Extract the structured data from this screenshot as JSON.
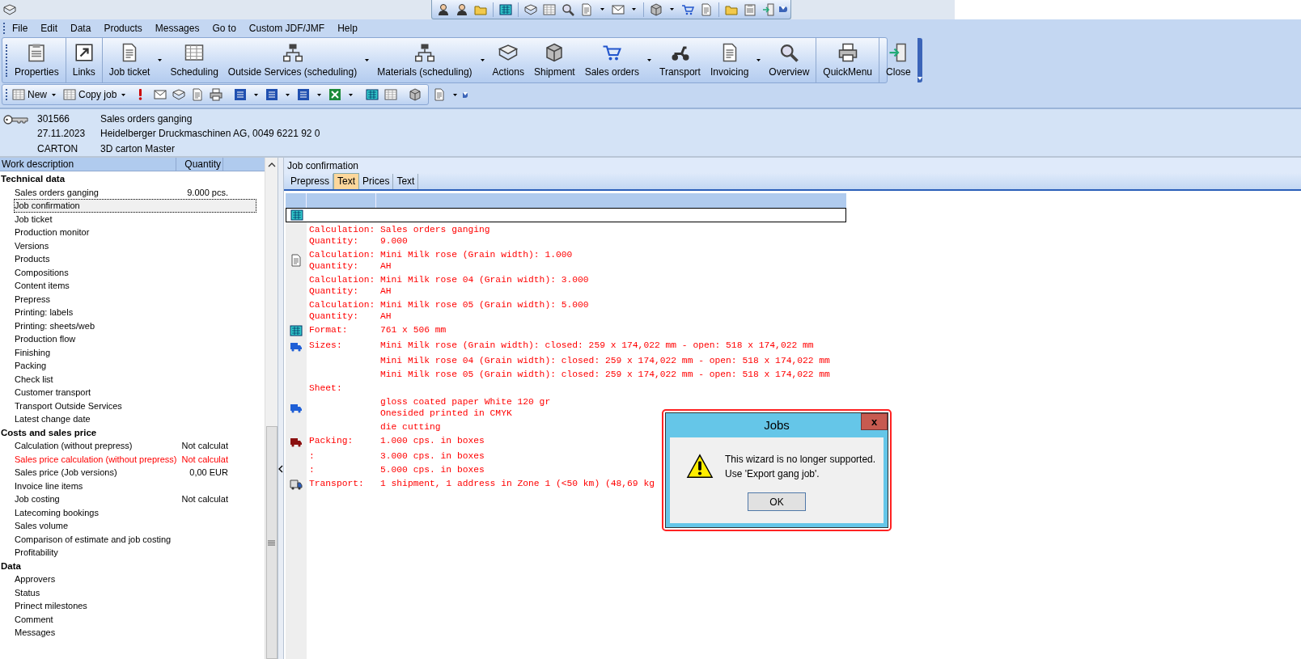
{
  "menu": [
    "File",
    "Edit",
    "Data",
    "Products",
    "Messages",
    "Go to",
    "Custom JDF/JMF",
    "Help"
  ],
  "main_toolbar": {
    "groups": [
      {
        "buttons": [
          {
            "label": "Properties",
            "dropdown": false
          }
        ]
      },
      {
        "buttons": [
          {
            "label": "Links",
            "dropdown": false
          }
        ]
      },
      {
        "buttons": [
          {
            "label": "Job ticket",
            "dropdown": true
          },
          {
            "label": "Scheduling",
            "dropdown": false
          },
          {
            "label": "Outside Services (scheduling)",
            "dropdown": true
          },
          {
            "label": "Materials (scheduling)",
            "dropdown": true
          },
          {
            "label": "Actions",
            "dropdown": false
          },
          {
            "label": "Shipment",
            "dropdown": false
          },
          {
            "label": "Sales orders",
            "dropdown": true
          },
          {
            "label": "Transport",
            "dropdown": false
          },
          {
            "label": "Invoicing",
            "dropdown": true
          },
          {
            "label": "Overview",
            "dropdown": false
          }
        ]
      },
      {
        "buttons": [
          {
            "label": "QuickMenu",
            "dropdown": false
          }
        ]
      },
      {
        "buttons": [
          {
            "label": "Close",
            "dropdown": false
          }
        ]
      }
    ]
  },
  "small_toolbar": {
    "buttons": [
      {
        "label": "New",
        "dropdown": true
      },
      {
        "label": "Copy job",
        "dropdown": true
      }
    ]
  },
  "job_header": {
    "number": "301566",
    "name": "Sales orders ganging",
    "date": "27.11.2023",
    "customer": "Heidelberger Druckmaschinen AG, 0049 6221 92 0",
    "type": "CARTON",
    "product": "3D carton Master"
  },
  "work_list": {
    "columns": [
      "Work description",
      "Quantity"
    ],
    "groups": [
      {
        "label": "Technical data",
        "items": [
          {
            "label": "Sales orders ganging",
            "quantity": "9.000 pcs.",
            "selected": false,
            "warning": false
          },
          {
            "label": "Job confirmation",
            "selected": true,
            "warning": false
          },
          {
            "label": "Job ticket",
            "selected": false,
            "warning": false
          },
          {
            "label": "Production monitor",
            "selected": false,
            "warning": false
          },
          {
            "label": "Versions",
            "selected": false,
            "warning": false
          },
          {
            "label": "Products",
            "selected": false,
            "warning": false
          },
          {
            "label": "Compositions",
            "selected": false,
            "warning": false
          },
          {
            "label": "Content items",
            "selected": false,
            "warning": false
          },
          {
            "label": "Prepress",
            "selected": false,
            "warning": false
          },
          {
            "label": "Printing: labels",
            "selected": false,
            "warning": false
          },
          {
            "label": "Printing: sheets/web",
            "selected": false,
            "warning": false
          },
          {
            "label": "Production flow",
            "selected": false,
            "warning": false
          },
          {
            "label": "Finishing",
            "selected": false,
            "warning": false
          },
          {
            "label": "Packing",
            "selected": false,
            "warning": false
          },
          {
            "label": "Check list",
            "selected": false,
            "warning": false
          },
          {
            "label": "Customer transport",
            "selected": false,
            "warning": false
          },
          {
            "label": "Transport Outside Services",
            "selected": false,
            "warning": false
          },
          {
            "label": "Latest change date",
            "selected": false,
            "warning": false
          }
        ]
      },
      {
        "label": "Costs and sales price",
        "items": [
          {
            "label": "Calculation (without prepress)",
            "quantity": "Not calculat",
            "selected": false,
            "warning": false
          },
          {
            "label": "Sales price calculation (without prepress)",
            "quantity": "Not calculat",
            "selected": false,
            "warning": true
          },
          {
            "label": "Sales price (Job versions)",
            "quantity": "0,00 EUR",
            "selected": false,
            "warning": false
          },
          {
            "label": "Invoice line items",
            "selected": false,
            "warning": false
          },
          {
            "label": "Job costing",
            "quantity": "Not calculat",
            "selected": false,
            "warning": false
          },
          {
            "label": "Latecoming bookings",
            "selected": false,
            "warning": false
          },
          {
            "label": "Sales volume",
            "selected": false,
            "warning": false
          },
          {
            "label": "Comparison of estimate and job costing",
            "selected": false,
            "warning": false
          },
          {
            "label": "Profitability",
            "selected": false,
            "warning": false
          }
        ]
      },
      {
        "label": "Data",
        "items": [
          {
            "label": "Approvers",
            "selected": false,
            "warning": false
          },
          {
            "label": "Status",
            "selected": false,
            "warning": false
          },
          {
            "label": "Prinect milestones",
            "selected": false,
            "warning": false
          },
          {
            "label": "Comment",
            "selected": false,
            "warning": false
          },
          {
            "label": "Messages",
            "selected": false,
            "warning": false
          }
        ]
      }
    ]
  },
  "detail": {
    "title": "Job confirmation",
    "tabs": [
      {
        "label": "Prepress",
        "selected": false
      },
      {
        "label": "Text",
        "selected": true
      },
      {
        "label": "Prices",
        "selected": false
      },
      {
        "label": "Text",
        "selected": false
      }
    ],
    "blocks": [
      {
        "kind": "none",
        "lines": [
          {
            "label": "Calculation:",
            "value": "Sales orders ganging"
          },
          {
            "label": "Quantity:",
            "value": "9.000"
          }
        ]
      },
      {
        "kind": "document",
        "lines": [
          {
            "label": "Calculation:",
            "value": "Mini Milk rose (Grain width): 1.000"
          },
          {
            "label": "Quantity:",
            "value": "AH"
          }
        ]
      },
      {
        "kind": "none",
        "lines": [
          {
            "label": "Calculation:",
            "value": "Mini Milk rose 04 (Grain width): 3.000"
          },
          {
            "label": "Quantity:",
            "value": "AH"
          }
        ]
      },
      {
        "kind": "none",
        "lines": [
          {
            "label": "Calculation:",
            "value": "Mini Milk rose 05 (Grain width): 5.000"
          },
          {
            "label": "Quantity:",
            "value": "AH"
          }
        ]
      },
      {
        "kind": "calculator",
        "lines": [
          {
            "label": "Format:",
            "value": "761 x 506 mm"
          }
        ]
      },
      {
        "kind": "van",
        "lines": [
          {
            "label": "Sizes:",
            "value": "Mini Milk rose (Grain width): closed: 259 x 174,022 mm - open: 518 x 174,022 mm"
          }
        ]
      },
      {
        "kind": "none",
        "lines": [
          {
            "value": "Mini Milk rose 04 (Grain width): closed: 259 x 174,022 mm - open: 518 x 174,022 mm"
          }
        ]
      },
      {
        "kind": "none",
        "lines": [
          {
            "value": "Mini Milk rose 05 (Grain width): closed: 259 x 174,022 mm - open: 518 x 174,022 mm"
          }
        ]
      },
      {
        "kind": "none",
        "lines": [
          {
            "label": "Sheet:"
          }
        ]
      },
      {
        "kind": "van",
        "lines": [
          {
            "value": "gloss coated paper White 120 gr"
          },
          {
            "value": "Onesided printed in CMYK"
          }
        ]
      },
      {
        "kind": "none",
        "lines": [
          {
            "value": "die cutting"
          }
        ]
      },
      {
        "kind": "package",
        "lines": [
          {
            "label": "Packing:",
            "value": "1.000 cps. in boxes"
          }
        ]
      },
      {
        "kind": "none",
        "lines": [
          {
            "label": ":",
            "value": "3.000 cps. in boxes"
          }
        ]
      },
      {
        "kind": "none",
        "lines": [
          {
            "label": ":",
            "value": "5.000 cps. in boxes"
          }
        ]
      },
      {
        "kind": "truck",
        "lines": [
          {
            "label": "Transport:",
            "value": "1 shipment, 1 address in Zone 1 (<50 km) (48,69 kg"
          }
        ]
      }
    ]
  },
  "dialog": {
    "title": "Jobs",
    "close": "x",
    "message": [
      "This wizard is no longer supported.",
      "Use 'Export gang job'."
    ],
    "button": "OK"
  }
}
